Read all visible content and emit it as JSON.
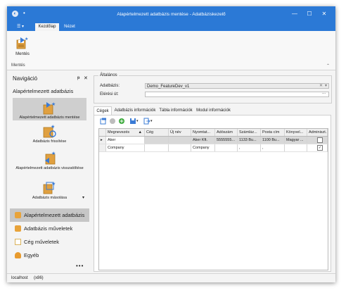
{
  "window": {
    "title": "Alapértelmezett adatbázis mentése - Adatbáziskezelő",
    "minimize": "—",
    "maximize": "☐",
    "close": "✕"
  },
  "ribbon": {
    "file_menu": "☰ ▾",
    "tabs": [
      {
        "label": "Kezdőlap",
        "active": true
      },
      {
        "label": "Nézet",
        "active": false
      }
    ],
    "buttons": [
      {
        "label": "Mentés",
        "icon": "save-icon"
      }
    ],
    "group_label": "Mentés",
    "collapse_glyph": "⌃"
  },
  "navigation": {
    "header": "Navigáció",
    "pin_glyph": "ᵽ",
    "close_glyph": "✕",
    "section_title": "Alapértelmezett adatbázis",
    "items": [
      {
        "label": "Alapértelmezett adatbázis mentése",
        "selected": true,
        "icon": "database-save-icon"
      },
      {
        "label": "Adatbázis frissítése",
        "selected": false,
        "icon": "database-refresh-icon"
      },
      {
        "label": "Alapértelmezett adatbázis visszatöltése",
        "selected": false,
        "icon": "database-restore-icon"
      },
      {
        "label": "Adatbázis másolása",
        "selected": false,
        "icon": "database-copy-icon"
      }
    ],
    "more_glyph": "▾",
    "categories": [
      {
        "label": "Alapértelmezett adatbázis",
        "selected": true,
        "icon": "database-icon",
        "color": "#e8a33a"
      },
      {
        "label": "Adatbázis műveletek",
        "selected": false,
        "icon": "database-ops-icon",
        "color": "#e8a33a"
      },
      {
        "label": "Cég műveletek",
        "selected": false,
        "icon": "company-icon",
        "color": "#d9b25a"
      },
      {
        "label": "Egyéb",
        "selected": false,
        "icon": "person-icon",
        "color": "#e89b2e"
      }
    ],
    "overflow_dots": "•••"
  },
  "general": {
    "group_label": "Általános",
    "database_label": "Adatbázis:",
    "database_value": "Demo_FeatureDev_v1",
    "database_clear": "✕",
    "database_dropdown": "▾",
    "path_label": "Elérési út:",
    "path_value": "",
    "path_browse": "..."
  },
  "tabs": [
    {
      "label": "Cégek",
      "active": true
    },
    {
      "label": "Adatbázis információk",
      "active": false
    },
    {
      "label": "Tábla információk",
      "active": false
    },
    {
      "label": "Modul információk",
      "active": false
    }
  ],
  "grid": {
    "columns": [
      "Megnevezés",
      "Cég",
      "Új név",
      "Nyomtat...",
      "Adószám",
      "Számláz...",
      "Posta cím",
      "Könyvel...",
      "Adminiszt..."
    ],
    "sort_glyph": "▲",
    "rows": [
      {
        "indicator": "▸",
        "cells": [
          "Aker",
          "",
          "",
          "Aker Kft.",
          "5555555...",
          "1133 Bu...",
          "1100 Bu...",
          "Magyar ...",
          ""
        ],
        "checked": false,
        "selected": true
      },
      {
        "indicator": "",
        "cells": [
          "Company",
          "",
          "",
          "Company",
          "",
          ",",
          ",",
          "",
          ""
        ],
        "checked": true,
        "selected": false
      }
    ]
  },
  "status": {
    "server": "localhost",
    "arch": "(x86)"
  }
}
